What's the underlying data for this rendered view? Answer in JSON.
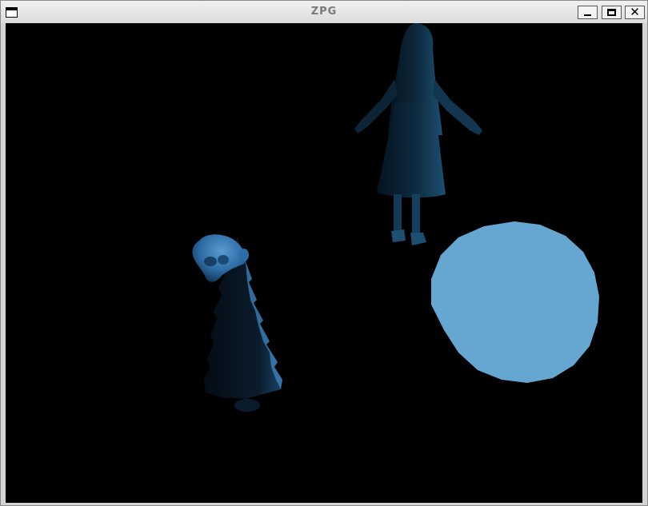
{
  "window": {
    "title": "ZPG",
    "controls": {
      "minimize_icon": "minimize-icon",
      "maximize_icon": "maximize-icon",
      "close_icon": "close-icon"
    }
  },
  "scene": {
    "background_color": "#000000",
    "objects": [
      "girl-figure",
      "tree",
      "monkey-head",
      "sphere"
    ],
    "colors": {
      "sphere": "#65a7d0",
      "girl_dark": "#071520",
      "girl_mid": "#123a55",
      "tree_dark": "#06101a",
      "tree_highlight": "#6fb0e6",
      "monkey": "#3a7cb8"
    }
  }
}
